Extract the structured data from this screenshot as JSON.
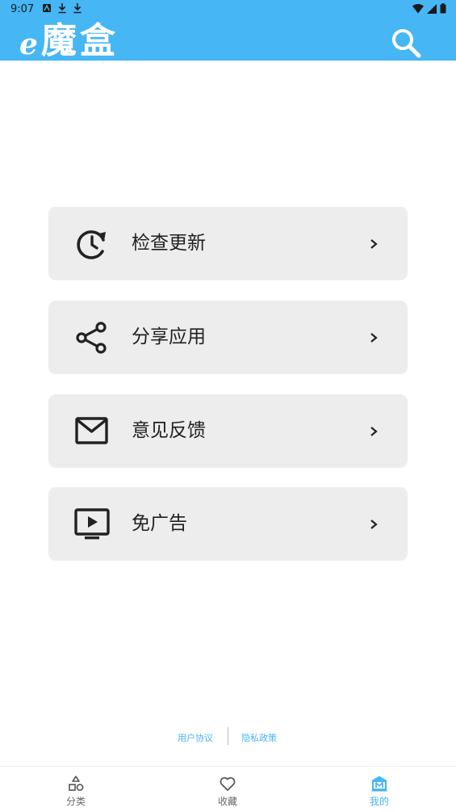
{
  "status_bar": {
    "time": "9:07"
  },
  "header": {
    "logo_e": "e",
    "logo_text": "魔盒",
    "search_icon": "search-icon"
  },
  "menu": [
    {
      "label": "检查更新",
      "icon": "update-clock-icon"
    },
    {
      "label": "分享应用",
      "icon": "share-icon"
    },
    {
      "label": "意见反馈",
      "icon": "mail-icon"
    },
    {
      "label": "免广告",
      "icon": "tv-play-icon"
    }
  ],
  "footer": {
    "user_agreement": "用户协议",
    "privacy_policy": "隐私政策"
  },
  "bottom_nav": [
    {
      "label": "分类",
      "icon": "category-shapes-icon",
      "active": false
    },
    {
      "label": "收藏",
      "icon": "heart-icon",
      "active": false
    },
    {
      "label": "我的",
      "icon": "mine-bank-icon",
      "active": true
    }
  ],
  "colors": {
    "accent": "#46b6f5",
    "card_bg": "#ededed",
    "text": "#1f1f1f"
  }
}
